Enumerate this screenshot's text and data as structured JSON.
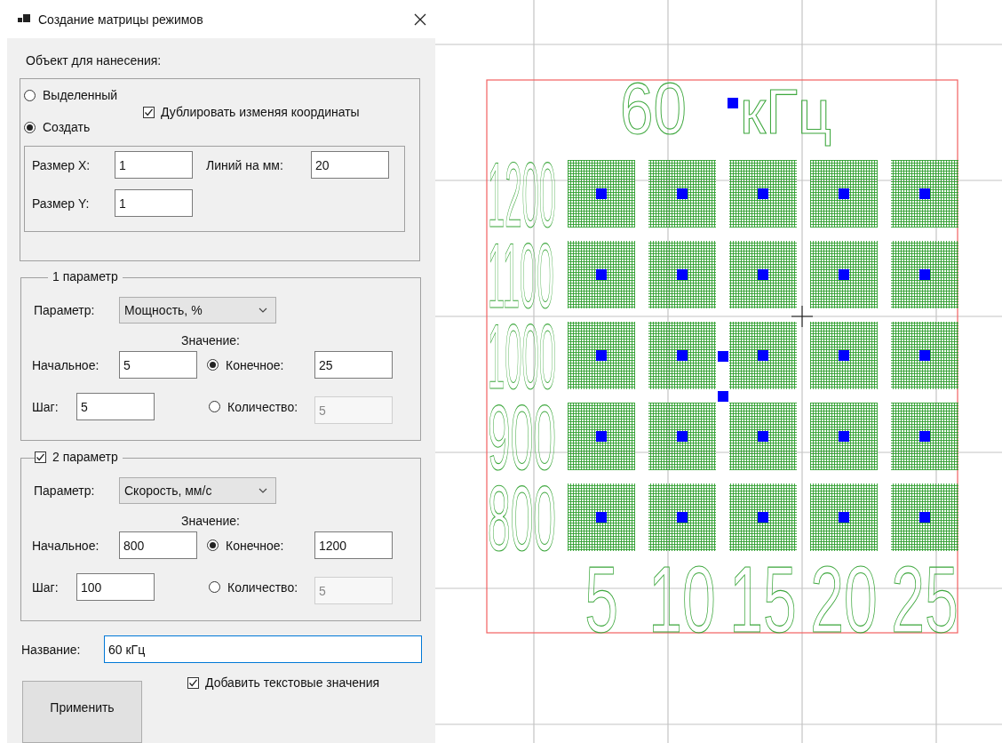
{
  "window": {
    "title": "Создание матрицы режимов"
  },
  "target": {
    "label": "Объект для нанесения:",
    "options": [
      {
        "label": "Выделенный",
        "selected": false
      },
      {
        "label": "Создать",
        "selected": true
      }
    ],
    "duplicate": {
      "label": "Дублировать изменяя координаты",
      "checked": true
    },
    "size_x": {
      "label": "Размер X:",
      "value": "1"
    },
    "lines_per_mm": {
      "label": "Линий на мм:",
      "value": "20"
    },
    "size_y": {
      "label": "Размер Y:",
      "value": "1"
    }
  },
  "parameters": [
    {
      "kind": "plain",
      "title": "1 параметр",
      "param_label": "Параметр:",
      "param_value": "Мощность, %",
      "value_heading": "Значение:",
      "start": {
        "label": "Начальное:",
        "value": "5"
      },
      "end": {
        "label": "Конечное:",
        "value": "25",
        "selected": true
      },
      "step": {
        "label": "Шаг:",
        "value": "5"
      },
      "count": {
        "label": "Количество:",
        "value": "5",
        "selected": false
      }
    },
    {
      "kind": "checkable",
      "checked": true,
      "title": "2 параметр",
      "param_label": "Параметр:",
      "param_value": "Скорость, мм/с",
      "value_heading": "Значение:",
      "start": {
        "label": "Начальное:",
        "value": "800"
      },
      "end": {
        "label": "Конечное:",
        "value": "1200",
        "selected": true
      },
      "step": {
        "label": "Шаг:",
        "value": "100"
      },
      "count": {
        "label": "Количество:",
        "value": "5",
        "selected": false
      }
    }
  ],
  "name": {
    "label": "Название:",
    "value": "60 кГц"
  },
  "add_text": {
    "label": "Добавить текстовые значения",
    "checked": true
  },
  "apply_button": "Применить",
  "canvas": {
    "title_value": "60",
    "title_unit": "кГц",
    "row_labels": [
      "1200",
      "1100",
      "1000",
      "900",
      "800"
    ],
    "column_labels": [
      "5",
      "10",
      "15",
      "20",
      "25"
    ]
  }
}
